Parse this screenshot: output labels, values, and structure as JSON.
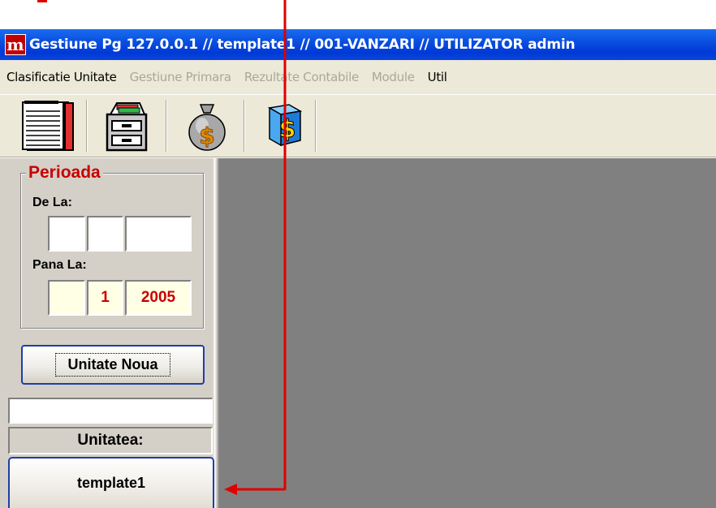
{
  "window": {
    "title": "Gestiune Pg 127.0.0.1 // template1 // 001-VANZARI // UTILIZATOR admin",
    "app_icon_glyph": "m"
  },
  "menu": [
    {
      "label": "Clasificatie Unitate",
      "enabled": true
    },
    {
      "label": "Gestiune Primara",
      "enabled": false
    },
    {
      "label": "Rezultate Contabile",
      "enabled": false
    },
    {
      "label": "Module",
      "enabled": false
    },
    {
      "label": "Util",
      "enabled": true
    }
  ],
  "toolbar": {
    "buttons": [
      {
        "icon": "notebook-icon"
      },
      {
        "icon": "filing-cabinet-icon"
      },
      {
        "icon": "money-bag-icon"
      },
      {
        "icon": "dollar-box-icon"
      }
    ]
  },
  "period": {
    "legend": "Perioada",
    "from_label": "De La:",
    "from_day": "",
    "from_month": "",
    "from_year": "",
    "to_label": "Pana La:",
    "to_day": "",
    "to_month": "1",
    "to_year": "2005"
  },
  "buttons": {
    "new_unit": "Unitate Noua"
  },
  "unit": {
    "search_value": "",
    "label": "Unitatea:",
    "current": "template1"
  },
  "colors": {
    "title_bar": "#0a4fe0",
    "legend_red": "#c80000",
    "annotation_arrow": "#e00000",
    "mdi_background": "#808080"
  }
}
